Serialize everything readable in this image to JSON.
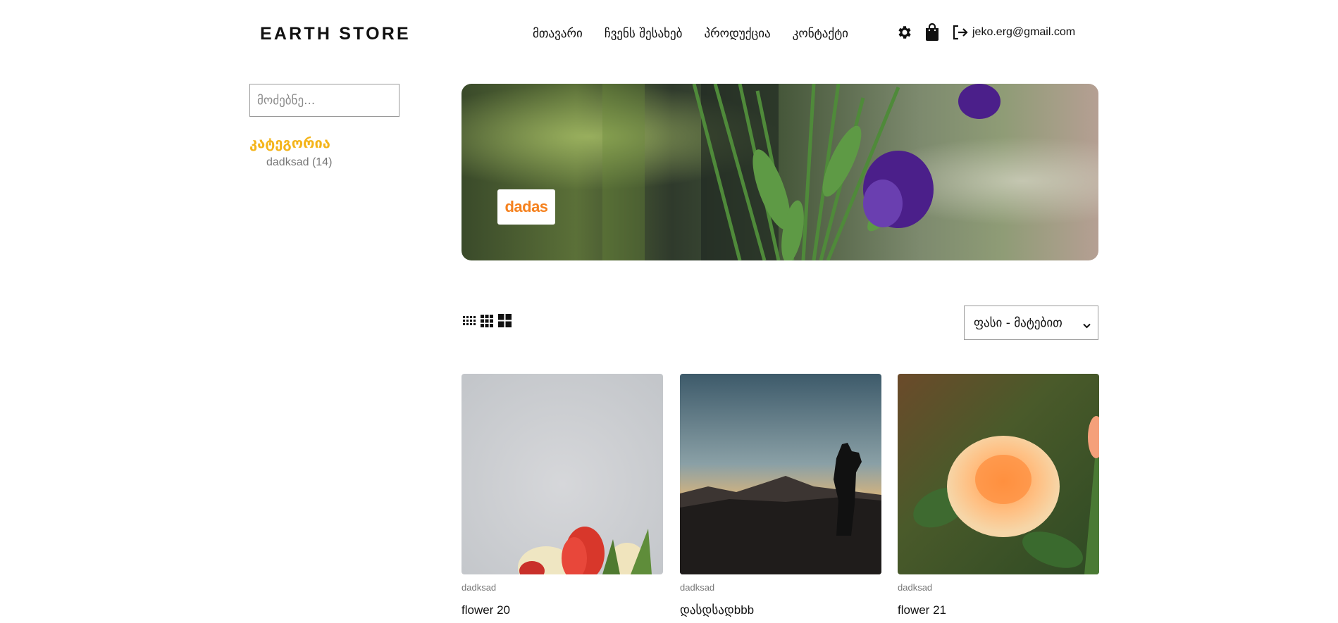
{
  "header": {
    "brand": "EARTH STORE",
    "nav": [
      "მთავარი",
      "ჩვენს შესახებ",
      "პროდუქცია",
      "კონტაქტი"
    ],
    "email": "jeko.erg@gmail.com"
  },
  "sidebar": {
    "search_placeholder": "მოძებნე...",
    "category_title": "კატეგორია",
    "category_item": "dadksad (14)"
  },
  "hero": {
    "badge": "dadas"
  },
  "toolbar": {
    "sort_value": "ფასი - მატებით"
  },
  "products": [
    {
      "category": "dadksad",
      "name": "flower 20"
    },
    {
      "category": "dadksad",
      "name": "დასდსადbbb"
    },
    {
      "category": "dadksad",
      "name": "flower 21"
    }
  ],
  "colors": {
    "accent_orange": "#f5811e",
    "category_yellow": "#f4b41a"
  }
}
